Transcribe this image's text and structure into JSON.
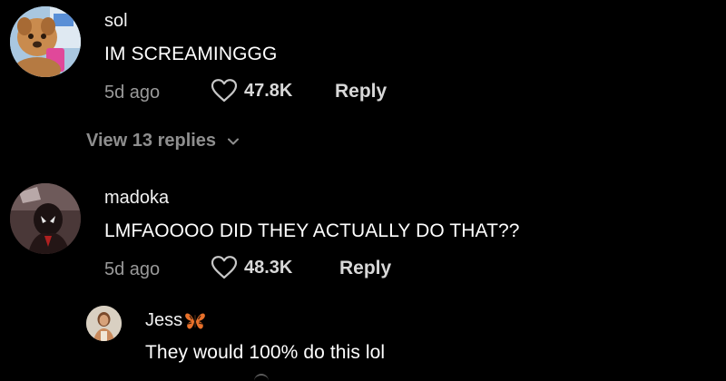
{
  "comments": [
    {
      "username": "sol",
      "text": "IM SCREAMINGGG",
      "age": "5d ago",
      "likes": "47.8K",
      "reply_label": "Reply",
      "view_replies": "View 13 replies"
    },
    {
      "username": "madoka",
      "text": "LMFAOOOO DID THEY ACTUALLY DO THAT??",
      "age": "5d ago",
      "likes": "48.3K",
      "reply_label": "Reply"
    }
  ],
  "reply": {
    "username": "Jess",
    "username_emoji": "butterfly-icon",
    "text": "They would 100% do this lol"
  },
  "colors": {
    "background": "#000000",
    "text_primary": "#ffffff",
    "text_secondary": "#9a9a9a",
    "butterfly": "#e8702a"
  }
}
